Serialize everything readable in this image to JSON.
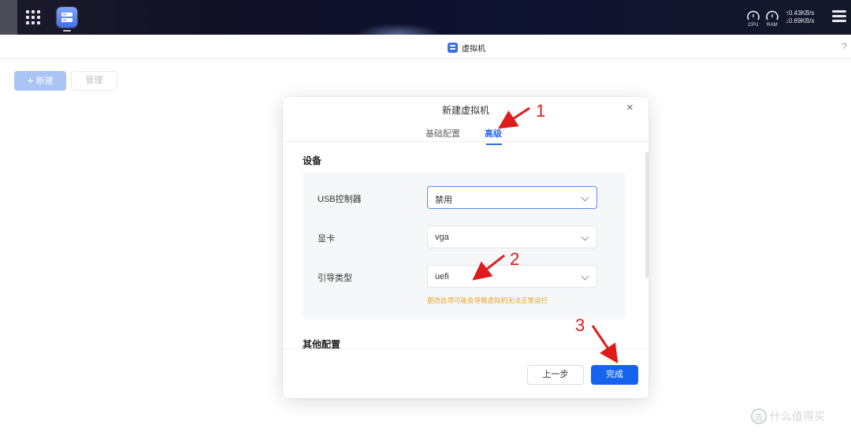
{
  "taskbar": {
    "cpu_label": "CPU",
    "ram_label": "RAM",
    "upload_speed": "↑0.43KB/s",
    "download_speed": "↓0.69KB/s"
  },
  "window": {
    "title": "虚拟机",
    "help": "?"
  },
  "toolbar": {
    "new_label": "新建",
    "manage_label": "管理"
  },
  "modal": {
    "title": "新建虚拟机",
    "close": "×",
    "tabs": [
      "基础配置",
      "高级"
    ],
    "active_tab": "高级",
    "section_devices": "设备",
    "fields": [
      {
        "label": "USB控制器",
        "value": "禁用"
      },
      {
        "label": "显卡",
        "value": "vga"
      },
      {
        "label": "引导类型",
        "value": "uefi"
      }
    ],
    "warning": "更改此项可能会导致虚拟机无法正常运行",
    "section_other": "其他配置",
    "prev_label": "上一步",
    "done_label": "完成"
  },
  "annotations": [
    "1",
    "2",
    "3"
  ],
  "watermark": "什么值得买",
  "colors": {
    "accent": "#1563ef",
    "warning": "#e8a22e",
    "annotation": "#e01b1b"
  }
}
